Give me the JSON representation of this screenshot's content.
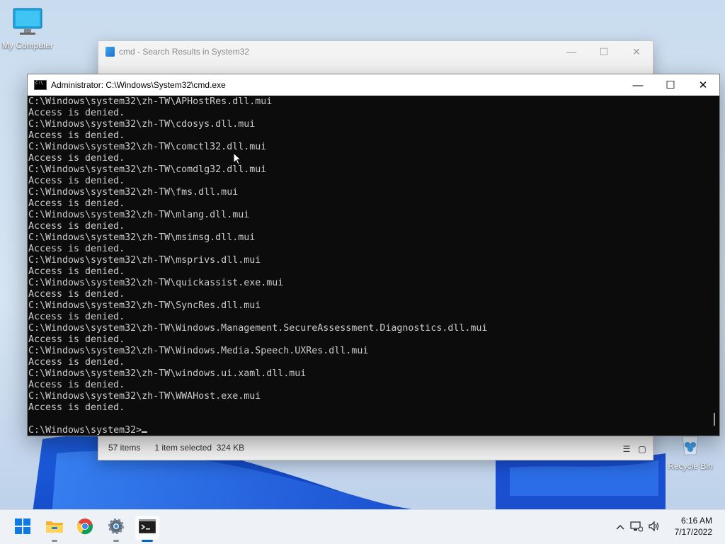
{
  "desktop": {
    "icons": [
      {
        "label": "My Computer",
        "icon": "monitor-icon"
      },
      {
        "label": "Recycle Bin",
        "icon": "recycle-bin-icon"
      }
    ]
  },
  "explorer": {
    "title": "cmd - Search Results in System32",
    "status": {
      "item_count": "57 items",
      "selection": "1 item selected  324 KB"
    }
  },
  "cmd": {
    "title": "Administrator: C:\\Windows\\System32\\cmd.exe",
    "lines": [
      "C:\\Windows\\system32\\zh-TW\\APHostRes.dll.mui",
      "Access is denied.",
      "C:\\Windows\\system32\\zh-TW\\cdosys.dll.mui",
      "Access is denied.",
      "C:\\Windows\\system32\\zh-TW\\comctl32.dll.mui",
      "Access is denied.",
      "C:\\Windows\\system32\\zh-TW\\comdlg32.dll.mui",
      "Access is denied.",
      "C:\\Windows\\system32\\zh-TW\\fms.dll.mui",
      "Access is denied.",
      "C:\\Windows\\system32\\zh-TW\\mlang.dll.mui",
      "Access is denied.",
      "C:\\Windows\\system32\\zh-TW\\msimsg.dll.mui",
      "Access is denied.",
      "C:\\Windows\\system32\\zh-TW\\msprivs.dll.mui",
      "Access is denied.",
      "C:\\Windows\\system32\\zh-TW\\quickassist.exe.mui",
      "Access is denied.",
      "C:\\Windows\\system32\\zh-TW\\SyncRes.dll.mui",
      "Access is denied.",
      "C:\\Windows\\system32\\zh-TW\\Windows.Management.SecureAssessment.Diagnostics.dll.mui",
      "Access is denied.",
      "C:\\Windows\\system32\\zh-TW\\Windows.Media.Speech.UXRes.dll.mui",
      "Access is denied.",
      "C:\\Windows\\system32\\zh-TW\\windows.ui.xaml.dll.mui",
      "Access is denied.",
      "C:\\Windows\\system32\\zh-TW\\WWAHost.exe.mui",
      "Access is denied.",
      ""
    ],
    "prompt": "C:\\Windows\\system32>"
  },
  "taskbar": {
    "apps": [
      "start-icon",
      "file-explorer-icon",
      "chrome-icon",
      "settings-icon",
      "terminal-icon"
    ],
    "clock": {
      "time": "6:16 AM",
      "date": "7/17/2022"
    }
  },
  "colors": {
    "console_bg": "#0c0c0c",
    "console_fg": "#cccccc",
    "accent": "#0067c0"
  }
}
